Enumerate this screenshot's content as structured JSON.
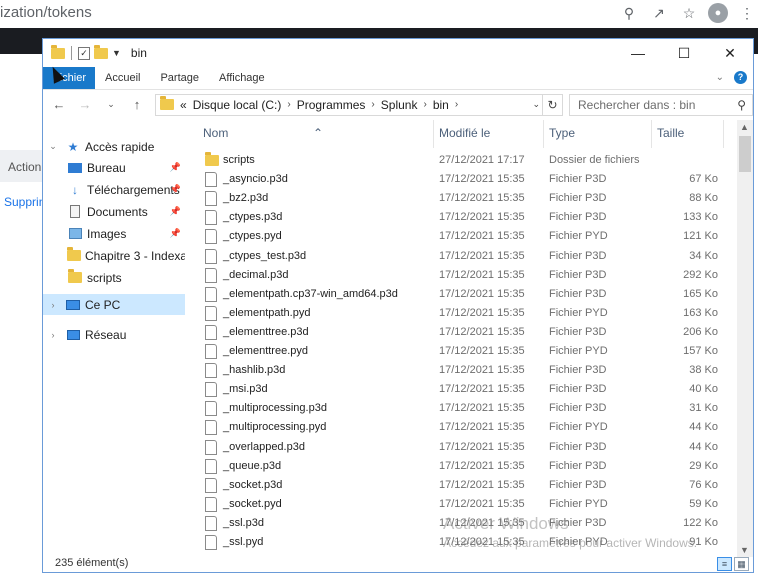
{
  "browser": {
    "url_text": "ization/tokens",
    "side_action": "Action",
    "side_supprimer": "Supprin"
  },
  "window": {
    "title": "bin",
    "minimize": "—",
    "maximize": "☐",
    "close": "✕"
  },
  "ribbon": {
    "tabs": [
      "Fichier",
      "Accueil",
      "Partage",
      "Affichage"
    ],
    "help": "?"
  },
  "address": {
    "overflow": "«",
    "crumbs": [
      "Disque local (C:)",
      "Programmes",
      "Splunk",
      "bin"
    ],
    "search_placeholder": "Rechercher dans : bin"
  },
  "nav": {
    "quick_access": "Accès rapide",
    "items": [
      {
        "label": "Bureau",
        "icon": "desktop-icon",
        "pinned": true
      },
      {
        "label": "Téléchargements",
        "icon": "download-icon",
        "pinned": true
      },
      {
        "label": "Documents",
        "icon": "documents-icon",
        "pinned": true
      },
      {
        "label": "Images",
        "icon": "images-icon",
        "pinned": true
      },
      {
        "label": "Chapitre 3 - Indexat",
        "icon": "folder-icon",
        "pinned": false
      },
      {
        "label": "scripts",
        "icon": "folder-icon",
        "pinned": false
      }
    ],
    "this_pc": "Ce PC",
    "network": "Réseau"
  },
  "columns": {
    "name": "Nom",
    "modified": "Modifié le",
    "type": "Type",
    "size": "Taille"
  },
  "files": [
    {
      "name": "scripts",
      "modified": "27/12/2021 17:17",
      "type": "Dossier de fichiers",
      "size": "",
      "folder": true
    },
    {
      "name": "_asyncio.p3d",
      "modified": "17/12/2021 15:35",
      "type": "Fichier P3D",
      "size": "67 Ko"
    },
    {
      "name": "_bz2.p3d",
      "modified": "17/12/2021 15:35",
      "type": "Fichier P3D",
      "size": "88 Ko"
    },
    {
      "name": "_ctypes.p3d",
      "modified": "17/12/2021 15:35",
      "type": "Fichier P3D",
      "size": "133 Ko"
    },
    {
      "name": "_ctypes.pyd",
      "modified": "17/12/2021 15:35",
      "type": "Fichier PYD",
      "size": "121 Ko"
    },
    {
      "name": "_ctypes_test.p3d",
      "modified": "17/12/2021 15:35",
      "type": "Fichier P3D",
      "size": "34 Ko"
    },
    {
      "name": "_decimal.p3d",
      "modified": "17/12/2021 15:35",
      "type": "Fichier P3D",
      "size": "292 Ko"
    },
    {
      "name": "_elementpath.cp37-win_amd64.p3d",
      "modified": "17/12/2021 15:35",
      "type": "Fichier P3D",
      "size": "165 Ko"
    },
    {
      "name": "_elementpath.pyd",
      "modified": "17/12/2021 15:35",
      "type": "Fichier PYD",
      "size": "163 Ko"
    },
    {
      "name": "_elementtree.p3d",
      "modified": "17/12/2021 15:35",
      "type": "Fichier P3D",
      "size": "206 Ko"
    },
    {
      "name": "_elementtree.pyd",
      "modified": "17/12/2021 15:35",
      "type": "Fichier PYD",
      "size": "157 Ko"
    },
    {
      "name": "_hashlib.p3d",
      "modified": "17/12/2021 15:35",
      "type": "Fichier P3D",
      "size": "38 Ko"
    },
    {
      "name": "_msi.p3d",
      "modified": "17/12/2021 15:35",
      "type": "Fichier P3D",
      "size": "40 Ko"
    },
    {
      "name": "_multiprocessing.p3d",
      "modified": "17/12/2021 15:35",
      "type": "Fichier P3D",
      "size": "31 Ko"
    },
    {
      "name": "_multiprocessing.pyd",
      "modified": "17/12/2021 15:35",
      "type": "Fichier PYD",
      "size": "44 Ko"
    },
    {
      "name": "_overlapped.p3d",
      "modified": "17/12/2021 15:35",
      "type": "Fichier P3D",
      "size": "44 Ko"
    },
    {
      "name": "_queue.p3d",
      "modified": "17/12/2021 15:35",
      "type": "Fichier P3D",
      "size": "29 Ko"
    },
    {
      "name": "_socket.p3d",
      "modified": "17/12/2021 15:35",
      "type": "Fichier P3D",
      "size": "76 Ko"
    },
    {
      "name": "_socket.pyd",
      "modified": "17/12/2021 15:35",
      "type": "Fichier PYD",
      "size": "59 Ko"
    },
    {
      "name": "_ssl.p3d",
      "modified": "17/12/2021 15:35",
      "type": "Fichier P3D",
      "size": "122 Ko"
    },
    {
      "name": "_ssl.pyd",
      "modified": "17/12/2021 15:35",
      "type": "Fichier PYD",
      "size": "91 Ko"
    }
  ],
  "status": {
    "count": "235 élément(s)"
  },
  "watermark": {
    "line1": "Activer Windows",
    "line2": "Accédez aux paramètres pour activer Windows."
  },
  "colors": {
    "accent": "#1979ca",
    "selection": "#cce8ff",
    "folder": "#f0c94d"
  }
}
